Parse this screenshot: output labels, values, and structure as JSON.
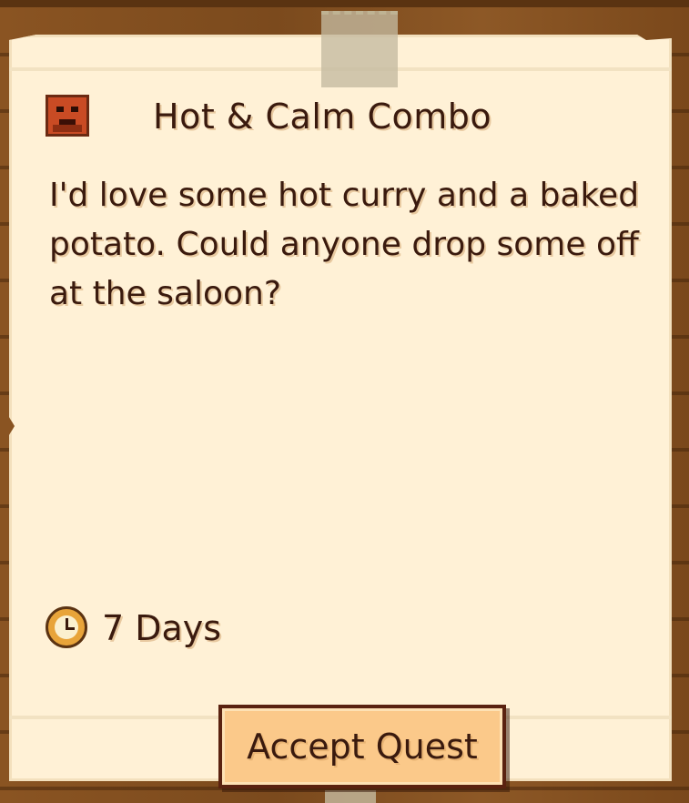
{
  "quest": {
    "title": "Hot & Calm Combo",
    "description": "I'd love some hot curry and a baked potato. Could anyone drop some off at the saloon?",
    "days_left": "7 Days",
    "accept_label": "Accept Quest",
    "requester_icon": "villager-portrait-icon",
    "timer_icon": "clock-icon"
  },
  "colors": {
    "paper": "#fff1d6",
    "board": "#7b4a1d",
    "text": "#3a1a0e",
    "button": "#fbc98a"
  }
}
